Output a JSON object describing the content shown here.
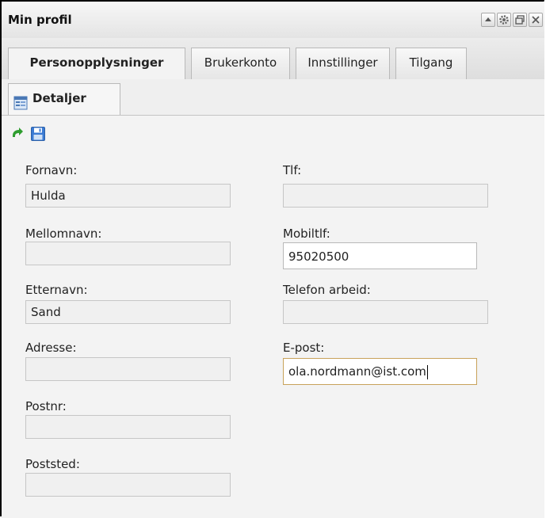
{
  "window": {
    "title": "Min profil"
  },
  "tabs": [
    {
      "label": "Personopplysninger",
      "active": true
    },
    {
      "label": "Brukerkonto"
    },
    {
      "label": "Innstillinger"
    },
    {
      "label": "Tilgang"
    }
  ],
  "subtab": {
    "label": "Detaljer",
    "icon": "details-icon"
  },
  "toolbar": {
    "icons": [
      "refresh-icon",
      "save-icon"
    ]
  },
  "form": {
    "fornavn": {
      "label": "Fornavn:",
      "value": "Hulda"
    },
    "mellomnavn": {
      "label": "Mellomnavn:",
      "value": ""
    },
    "etternavn": {
      "label": "Etternavn:",
      "value": "Sand"
    },
    "adresse": {
      "label": "Adresse:",
      "value": ""
    },
    "postnr": {
      "label": "Postnr:",
      "value": ""
    },
    "poststed": {
      "label": "Poststed:",
      "value": ""
    },
    "tlf": {
      "label": "Tlf:",
      "value": ""
    },
    "mobiltlf": {
      "label": "Mobiltlf:",
      "value": "95020500"
    },
    "telefon_arbeid": {
      "label": "Telefon arbeid:",
      "value": ""
    },
    "epost": {
      "label": "E-post:",
      "value": "ola.nordmann@ist.com"
    }
  },
  "colors": {
    "focus_border": "#c8a25a",
    "refresh_green": "#2e9d2e",
    "save_blue": "#3b7bd4"
  }
}
